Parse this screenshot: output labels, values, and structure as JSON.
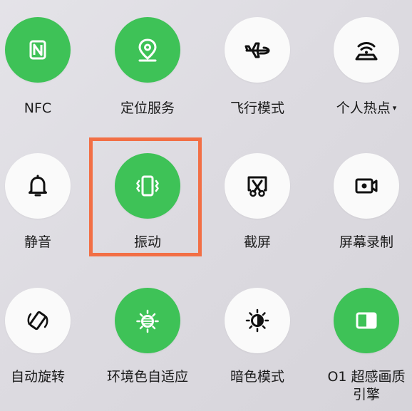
{
  "colors": {
    "active": "#3ec257",
    "inactive": "#fafafa",
    "highlight": "#f26f45"
  },
  "tiles": [
    {
      "label": "NFC",
      "state": "on",
      "icon": "nfc-icon"
    },
    {
      "label": "定位服务",
      "state": "on",
      "icon": "location-pin-icon"
    },
    {
      "label": "飞行模式",
      "state": "off",
      "icon": "airplane-icon"
    },
    {
      "label": "个人热点",
      "state": "off",
      "icon": "hotspot-icon",
      "dropdown": "▾"
    },
    {
      "label": "静音",
      "state": "off",
      "icon": "bell-icon"
    },
    {
      "label": "振动",
      "state": "on",
      "icon": "vibrate-icon"
    },
    {
      "label": "截屏",
      "state": "off",
      "icon": "screenshot-scissors-icon"
    },
    {
      "label": "屏幕录制",
      "state": "off",
      "icon": "screen-record-icon"
    },
    {
      "label": "自动旋转",
      "state": "off",
      "icon": "auto-rotate-icon"
    },
    {
      "label": "环境色自适应",
      "state": "on",
      "icon": "ambient-color-icon"
    },
    {
      "label": "暗色模式",
      "state": "off",
      "icon": "dark-mode-icon"
    },
    {
      "label": "O1 超感画质",
      "label_line2": "引擎",
      "state": "on",
      "icon": "o1-engine-icon"
    }
  ]
}
